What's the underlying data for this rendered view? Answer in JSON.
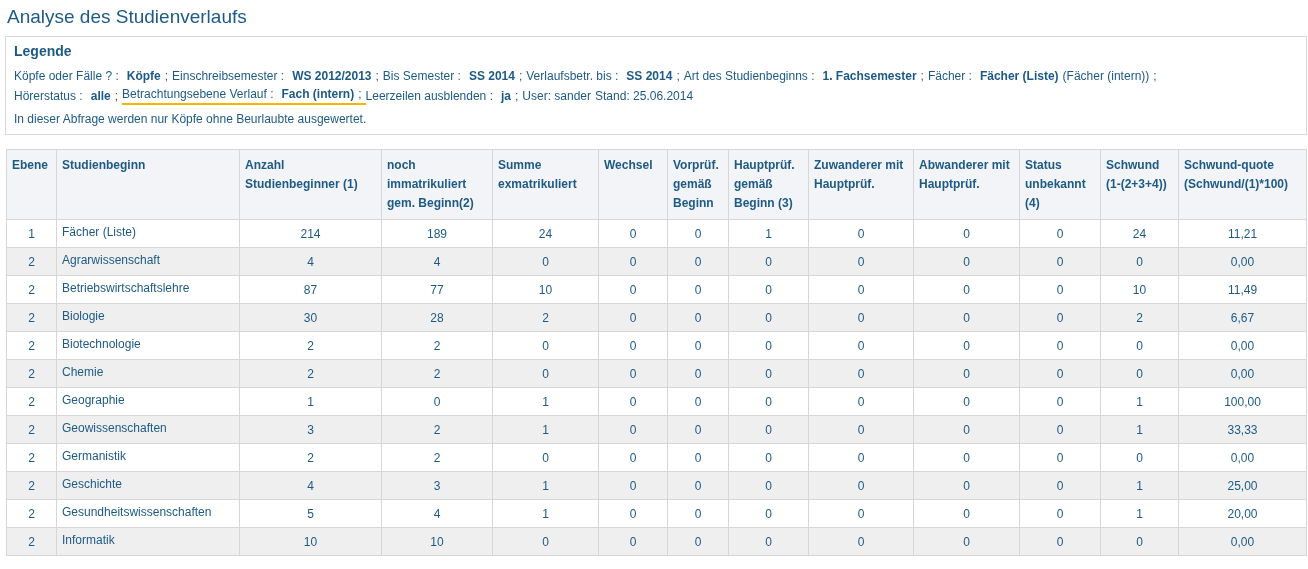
{
  "title": "Analyse des Studienverlaufs",
  "legend": {
    "heading": "Legende",
    "lines": [
      [
        {
          "label": "Köpfe oder Fälle ? :",
          "value": "Köpfe",
          "separator": ";",
          "highlighted": false
        },
        {
          "label": "Einschreibsemester :",
          "value": "WS 2012/2013",
          "separator": ";",
          "highlighted": false
        },
        {
          "label": "Bis Semester :",
          "value": "SS 2014",
          "separator": ";",
          "highlighted": false
        },
        {
          "label": "Verlaufsbetr. bis :",
          "value": "SS 2014",
          "separator": ";",
          "highlighted": false
        },
        {
          "label": "Art des Studienbeginns :",
          "value": "1. Fachsemester",
          "separator": ";",
          "highlighted": false
        },
        {
          "label": "Fächer :",
          "value": "Fächer (Liste)",
          "note": "(Fächer (intern))",
          "separator": ";",
          "highlighted": false
        }
      ],
      [
        {
          "label": "Hörerstatus :",
          "value": "alle",
          "separator": ";",
          "highlighted": false
        },
        {
          "label": "Betrachtungsebene Verlauf :",
          "value": "Fach (intern)",
          "separator": ";",
          "highlighted": true
        },
        {
          "label": "Leerzeilen ausblenden :",
          "value": "ja",
          "separator": ";",
          "highlighted": false
        },
        {
          "label": "User: sander",
          "highlighted": false
        },
        {
          "label": "Stand: 25.06.2014",
          "highlighted": false
        }
      ]
    ],
    "note": "In dieser Abfrage werden nur Köpfe ohne Beurlaubte ausgewertet."
  },
  "table": {
    "columns": [
      "Ebene",
      "Studienbeginn",
      "Anzahl Studienbeginner (1)",
      "noch immatrikuliert gem. Beginn(2)",
      "Summe exmatrikuliert",
      "Wechsel",
      "Vorprüf. gemäß Beginn",
      "Hauptprüf. gemäß Beginn (3)",
      "Zuwanderer mit Hauptprüf.",
      "Abwanderer mit Hauptprüf.",
      "Status unbekannt (4)",
      "Schwund (1-(2+3+4))",
      "Schwund-quote (Schwund/(1)*100)"
    ],
    "rows": [
      [
        "1",
        "Fächer (Liste)",
        "214",
        "189",
        "24",
        "0",
        "0",
        "1",
        "0",
        "0",
        "0",
        "24",
        "11,21"
      ],
      [
        "2",
        "Agrarwissenschaft",
        "4",
        "4",
        "0",
        "0",
        "0",
        "0",
        "0",
        "0",
        "0",
        "0",
        "0,00"
      ],
      [
        "2",
        "Betriebswirtschaftslehre",
        "87",
        "77",
        "10",
        "0",
        "0",
        "0",
        "0",
        "0",
        "0",
        "10",
        "11,49"
      ],
      [
        "2",
        "Biologie",
        "30",
        "28",
        "2",
        "0",
        "0",
        "0",
        "0",
        "0",
        "0",
        "2",
        "6,67"
      ],
      [
        "2",
        "Biotechnologie",
        "2",
        "2",
        "0",
        "0",
        "0",
        "0",
        "0",
        "0",
        "0",
        "0",
        "0,00"
      ],
      [
        "2",
        "Chemie",
        "2",
        "2",
        "0",
        "0",
        "0",
        "0",
        "0",
        "0",
        "0",
        "0",
        "0,00"
      ],
      [
        "2",
        "Geographie",
        "1",
        "0",
        "1",
        "0",
        "0",
        "0",
        "0",
        "0",
        "0",
        "1",
        "100,00"
      ],
      [
        "2",
        "Geowissenschaften",
        "3",
        "2",
        "1",
        "0",
        "0",
        "0",
        "0",
        "0",
        "0",
        "1",
        "33,33"
      ],
      [
        "2",
        "Germanistik",
        "2",
        "2",
        "0",
        "0",
        "0",
        "0",
        "0",
        "0",
        "0",
        "0",
        "0,00"
      ],
      [
        "2",
        "Geschichte",
        "4",
        "3",
        "1",
        "0",
        "0",
        "0",
        "0",
        "0",
        "0",
        "1",
        "25,00"
      ],
      [
        "2",
        "Gesundheitswissenschaften",
        "5",
        "4",
        "1",
        "0",
        "0",
        "0",
        "0",
        "0",
        "0",
        "1",
        "20,00"
      ],
      [
        "2",
        "Informatik",
        "10",
        "10",
        "0",
        "0",
        "0",
        "0",
        "0",
        "0",
        "0",
        "0",
        "0,00"
      ]
    ]
  }
}
